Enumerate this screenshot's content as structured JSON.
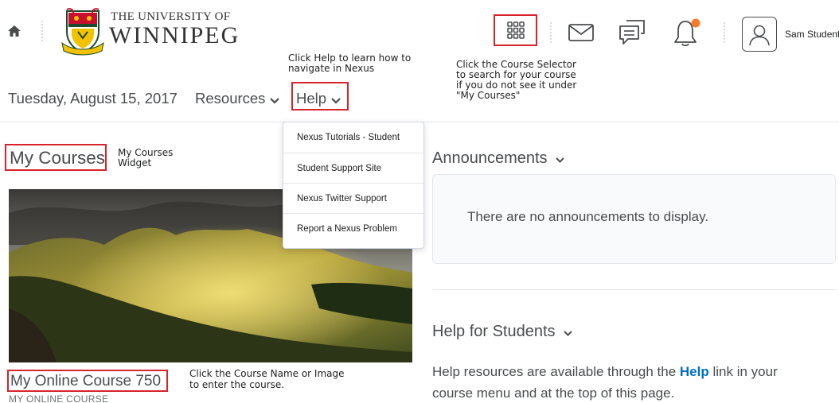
{
  "header": {
    "logo_small": "THE UNIVERSITY OF",
    "logo_large": "WINNIPEG",
    "user_name": "Sam Student",
    "colors": {
      "annotation_red": "#d8232a",
      "notification_dot": "#f47c2b",
      "link_blue": "#006fbf"
    },
    "icons": [
      "home-icon",
      "course-selector-grid-icon",
      "mail-icon",
      "chat-icon",
      "bell-icon",
      "user-avatar-icon"
    ]
  },
  "nav": {
    "date": "Tuesday, August 15, 2017",
    "resources_label": "Resources",
    "help_label": "Help"
  },
  "help_menu": {
    "items": [
      {
        "label": "Nexus Tutorials - Student"
      },
      {
        "label": "Student Support Site"
      },
      {
        "label": "Nexus Twitter Support"
      },
      {
        "label": "Report a Nexus Problem"
      }
    ]
  },
  "notes": {
    "help_note_1": "Click Help to learn how to",
    "help_note_2": "navigate in Nexus",
    "selector_note_1": "Click the Course Selector",
    "selector_note_2": "to search for your course",
    "selector_note_3": "if you do not see it under",
    "selector_note_4": "\"My Courses\"",
    "widget_note_1": "My Courses",
    "widget_note_2": "Widget",
    "course_note_1": "Click the Course Name or Image",
    "course_note_2": "to enter the course."
  },
  "my_courses": {
    "title": "My Courses",
    "course_name": "My Online Course 750",
    "course_code": "MY ONLINE COURSE"
  },
  "announcements": {
    "title": "Announcements",
    "empty_text": "There are no announcements to display."
  },
  "help_students": {
    "title": "Help for Students",
    "text_before": "Help resources are available through the ",
    "link_text": "Help",
    "text_after": " link in your",
    "line2": "course menu and at the top of this page."
  }
}
